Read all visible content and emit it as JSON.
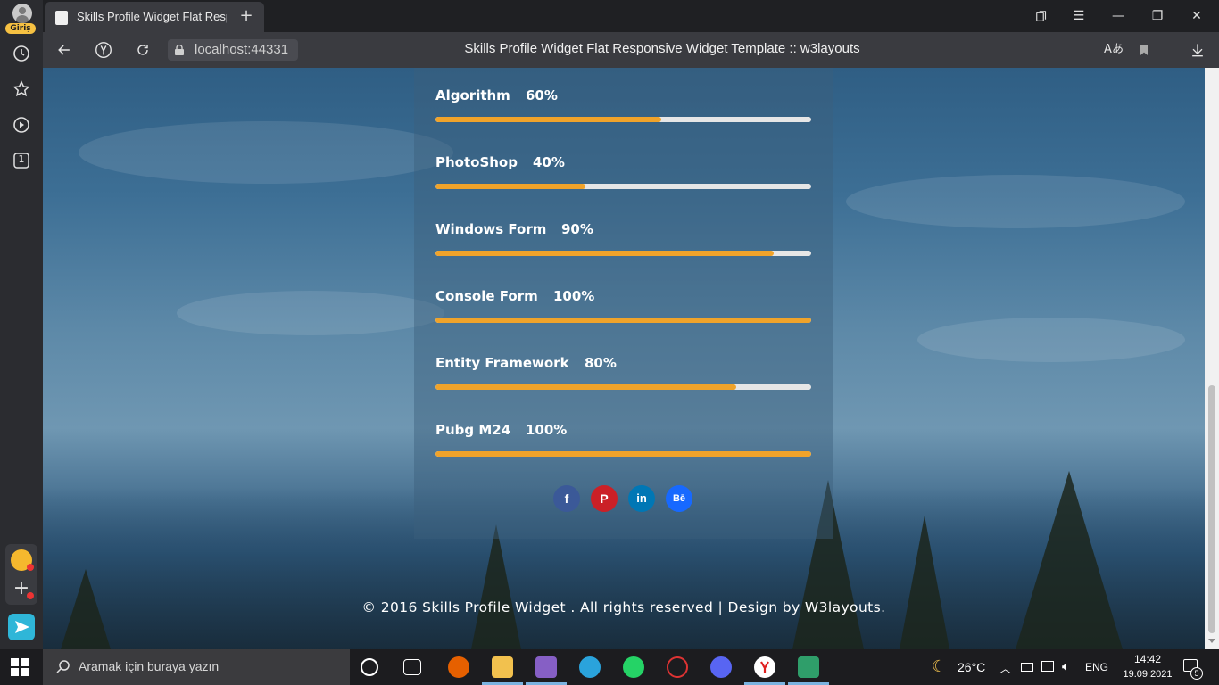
{
  "browser": {
    "profile_label": "Giriş",
    "tab_title": "Skills Profile Widget Flat Responsive Widget Template :: w3layouts",
    "tab_close_glyph": "×",
    "new_tab_glyph": "+",
    "url": "localhost:44331",
    "page_title": "Skills Profile Widget Flat Responsive Widget Template :: w3layouts",
    "sidebar_counter": "1",
    "window_controls": {
      "minimize": "—",
      "restore": "❐",
      "close": "✕",
      "menu": "☰"
    }
  },
  "skills": [
    {
      "name": "Algorithm",
      "percent_label": "60%",
      "value": 60
    },
    {
      "name": "PhotoShop",
      "percent_label": "40%",
      "value": 40
    },
    {
      "name": "Windows Form",
      "percent_label": "90%",
      "value": 90
    },
    {
      "name": "Console Form",
      "percent_label": "100%",
      "value": 100
    },
    {
      "name": "Entity Framework",
      "percent_label": "80%",
      "value": 80
    },
    {
      "name": "Pubg M24",
      "percent_label": "100%",
      "value": 100
    }
  ],
  "social": [
    {
      "icon": "facebook-icon",
      "glyph": "f",
      "color": "#3b5998"
    },
    {
      "icon": "pinterest-icon",
      "glyph": "P",
      "color": "#cb2027"
    },
    {
      "icon": "linkedin-icon",
      "glyph": "in",
      "color": "#0077b5"
    },
    {
      "icon": "behance-icon",
      "glyph": "Bē",
      "color": "#1769ff"
    }
  ],
  "footer": {
    "text": "© 2016 Skills Profile Widget . All rights reserved | Design by W3layouts."
  },
  "colors": {
    "progress_fill": "#f0a32a",
    "progress_track": "#e6e6e6"
  },
  "taskbar": {
    "search_placeholder": "Aramak için buraya yazın",
    "weather": "26°C",
    "language": "ENG",
    "time": "14:42",
    "date": "19.09.2021",
    "notification_count": "5"
  }
}
